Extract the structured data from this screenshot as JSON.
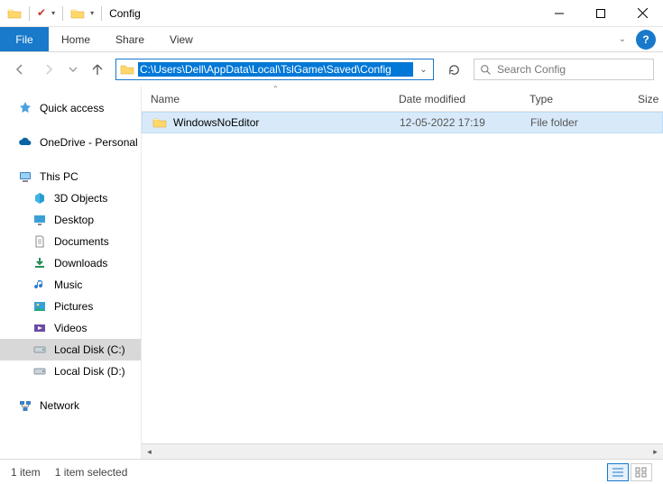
{
  "window": {
    "title": "Config"
  },
  "ribbon": {
    "file": "File",
    "tabs": [
      "Home",
      "Share",
      "View"
    ]
  },
  "address": {
    "path": "C:\\Users\\Dell\\AppData\\Local\\TslGame\\Saved\\Config"
  },
  "search": {
    "placeholder": "Search Config"
  },
  "nav": {
    "quick_access": "Quick access",
    "onedrive": "OneDrive - Personal",
    "this_pc": "This PC",
    "pc_children": [
      "3D Objects",
      "Desktop",
      "Documents",
      "Downloads",
      "Music",
      "Pictures",
      "Videos",
      "Local Disk (C:)",
      "Local Disk (D:)"
    ],
    "network": "Network"
  },
  "columns": {
    "name": "Name",
    "modified": "Date modified",
    "type": "Type",
    "size": "Size"
  },
  "files": [
    {
      "name": "WindowsNoEditor",
      "modified": "12-05-2022 17:19",
      "type": "File folder"
    }
  ],
  "status": {
    "count": "1 item",
    "selected": "1 item selected"
  }
}
